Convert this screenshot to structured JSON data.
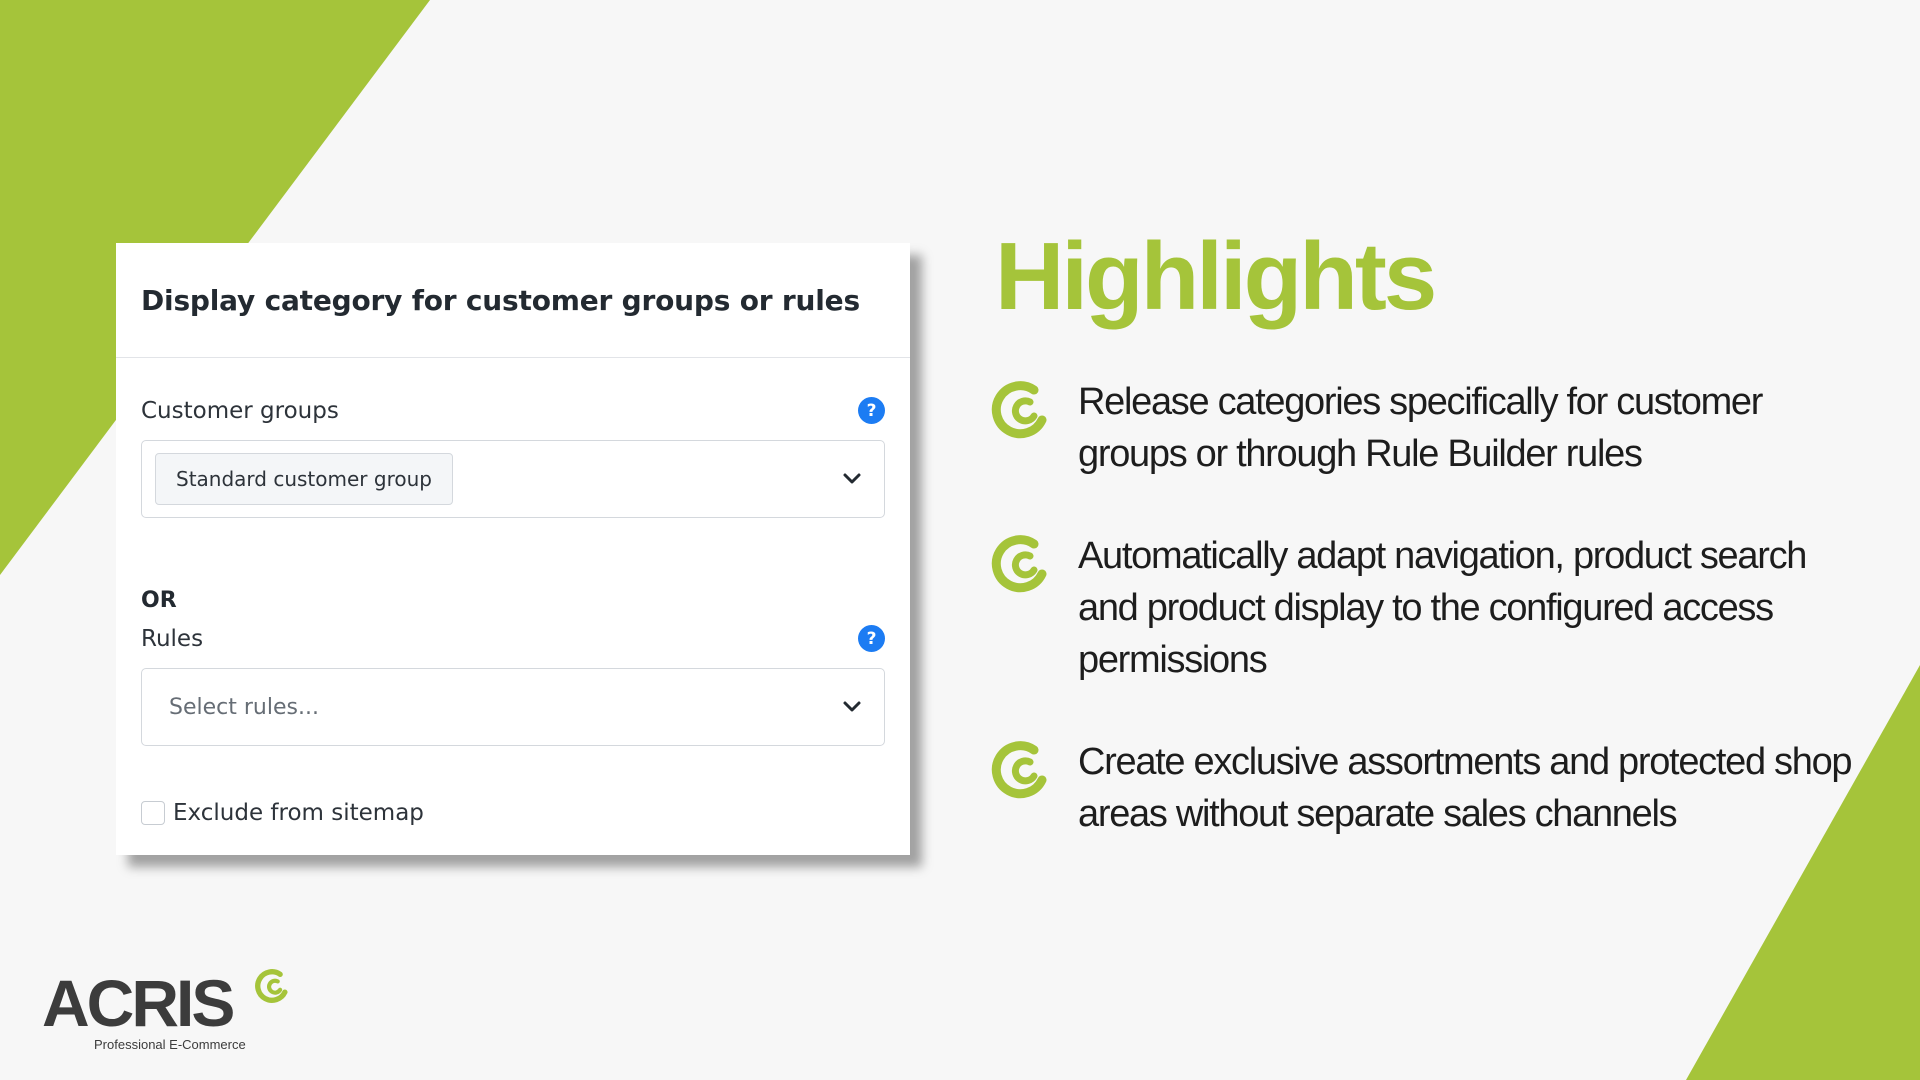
{
  "colors": {
    "accent_green": "#a5c43a",
    "background": "#f7f7f7",
    "help_blue": "#1c7cf3"
  },
  "card": {
    "title": "Display category for customer groups or rules",
    "customer_groups": {
      "label": "Customer groups",
      "help_icon": "question-mark-icon",
      "selected_tag": "Standard customer group"
    },
    "or_label": "OR",
    "rules": {
      "label": "Rules",
      "help_icon": "question-mark-icon",
      "placeholder": "Select rules..."
    },
    "exclude_sitemap": {
      "label": "Exclude from sitemap",
      "checked": false
    }
  },
  "highlights": {
    "title": "Highlights",
    "items": [
      {
        "icon": "acris-c-icon",
        "text": "Release categories specifically for customer groups or through Rule Builder rules"
      },
      {
        "icon": "acris-c-icon",
        "text": "Automatically adapt navigation, product search and product display to the configured access permissions"
      },
      {
        "icon": "acris-c-icon",
        "text": "Create exclusive assortments and protected shop areas without separate sales channels"
      }
    ]
  },
  "logo": {
    "wordmark": "ACRIS",
    "tagline": "Professional E-Commerce"
  }
}
